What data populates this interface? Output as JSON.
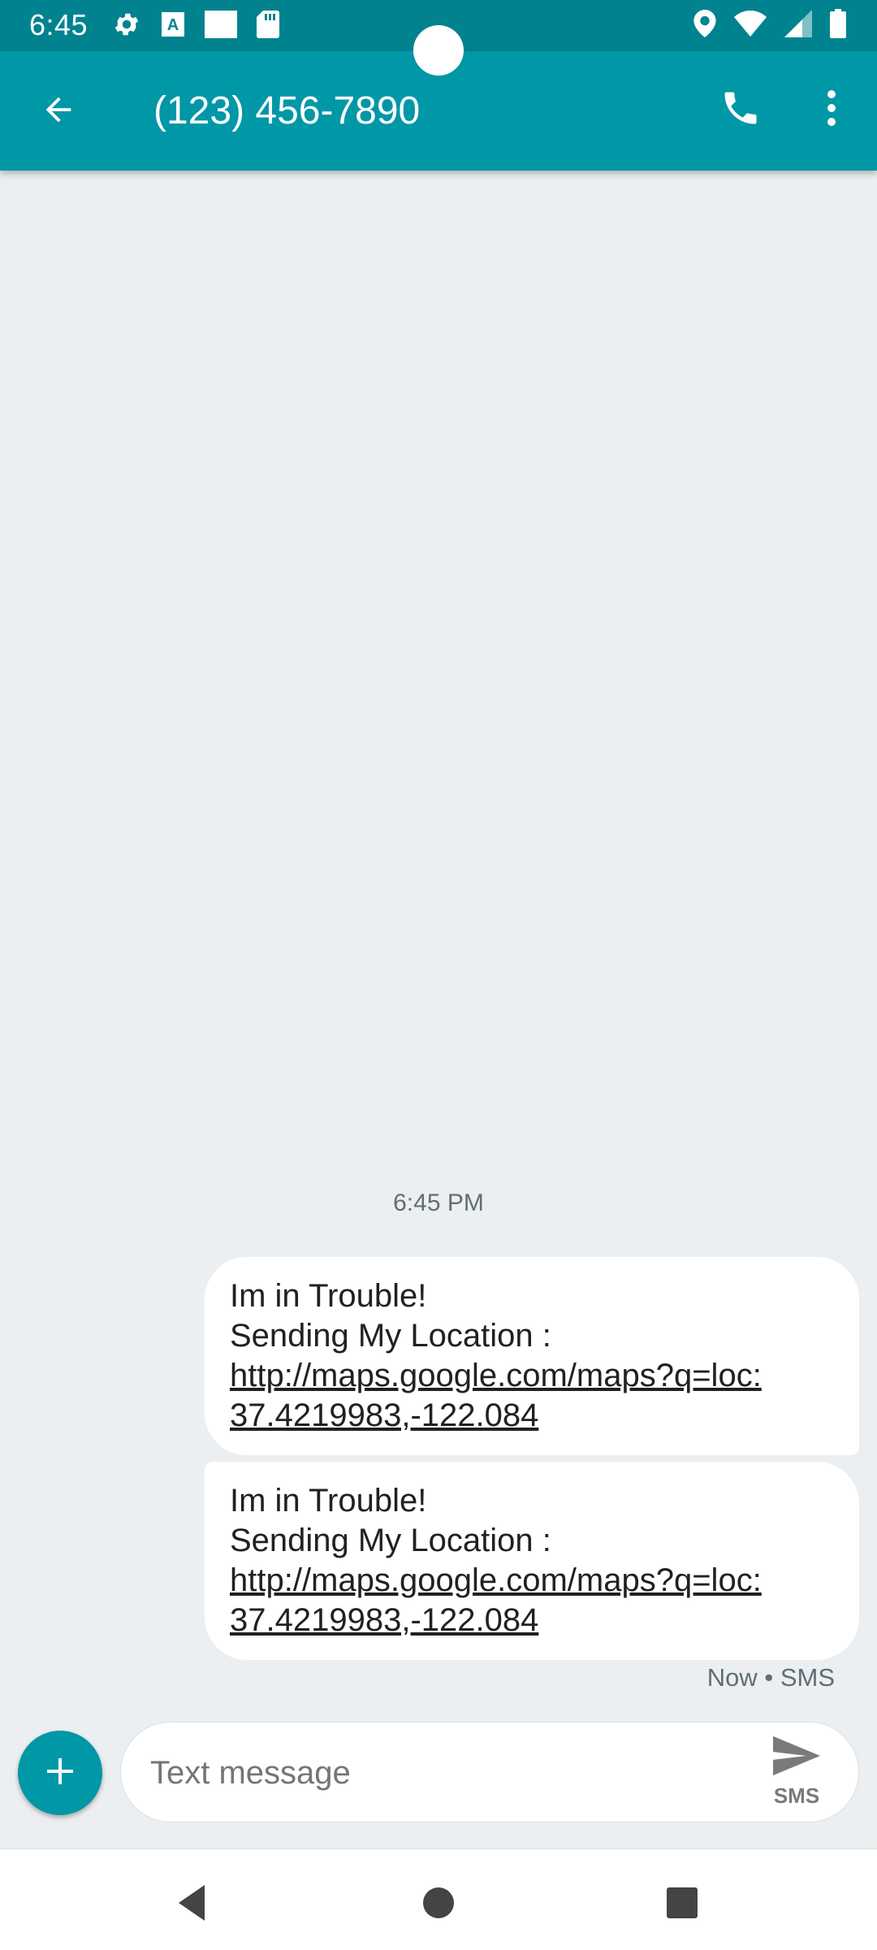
{
  "status_bar": {
    "time": "6:45",
    "left_icons": [
      "gear-icon",
      "font-a-icon",
      "white-square-icon",
      "sd-card-icon"
    ],
    "right_icons": [
      "location-pin-icon",
      "wifi-icon",
      "signal-icon",
      "battery-icon"
    ]
  },
  "app_bar": {
    "title": "(123) 456-7890",
    "back_icon": "arrow-left-icon",
    "call_icon": "phone-icon",
    "more_icon": "more-vertical-icon"
  },
  "conversation": {
    "timestamp": "6:45 PM",
    "messages": [
      {
        "line1": "Im in Trouble!",
        "line2": "Sending My Location :",
        "link_line1": "http://maps.google.com/maps?q=loc:",
        "link_line2": "37.4219983,-122.084"
      },
      {
        "line1": "Im in Trouble!",
        "line2": "Sending My Location :",
        "link_line1": "http://maps.google.com/maps?q=loc:",
        "link_line2": "37.4219983,-122.084"
      }
    ],
    "meta": "Now • SMS"
  },
  "compose": {
    "placeholder": "Text message",
    "send_label": "SMS",
    "add_icon": "plus-icon",
    "send_icon": "send-icon"
  },
  "nav_bar": {
    "icons": [
      "back-triangle-icon",
      "home-circle-icon",
      "recents-square-icon"
    ]
  },
  "colors": {
    "status_bar": "#00838f",
    "app_bar": "#0097a7",
    "background": "#eceff1",
    "bubble": "#ffffff",
    "fab": "#0097a7"
  }
}
